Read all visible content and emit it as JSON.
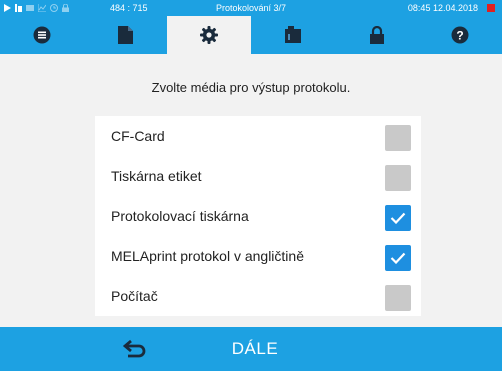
{
  "status_bar": {
    "coords": "484 : 715",
    "title": "Protokolování 3/7",
    "datetime": "08:45  12.04.2018",
    "icons": [
      "play-icon",
      "bars-icon",
      "heater-icon",
      "graph-icon",
      "clock-icon",
      "lock-icon"
    ],
    "alert_color": "#e02020"
  },
  "tabs": [
    {
      "icon": "list-icon",
      "active": false
    },
    {
      "icon": "document-icon",
      "active": false
    },
    {
      "icon": "gear-icon",
      "active": true
    },
    {
      "icon": "log-device-icon",
      "active": false
    },
    {
      "icon": "lock-icon",
      "active": false
    },
    {
      "icon": "help-icon",
      "active": false
    }
  ],
  "main": {
    "prompt": "Zvolte média pro výstup protokolu.",
    "options": [
      {
        "label": "CF-Card",
        "checked": false
      },
      {
        "label": "Tiskárna etiket",
        "checked": false
      },
      {
        "label": "Protokolovací tiskárna",
        "checked": true
      },
      {
        "label": "MELAprint protokol v angličtině",
        "checked": true
      },
      {
        "label": "Počítač",
        "checked": false
      }
    ]
  },
  "footer": {
    "back_icon": "back-arrow-icon",
    "next_label": "DÁLE"
  },
  "colors": {
    "accent": "#1da1e2",
    "checkbox_on": "#1e8fe0",
    "checkbox_off": "#c9c9c9"
  }
}
